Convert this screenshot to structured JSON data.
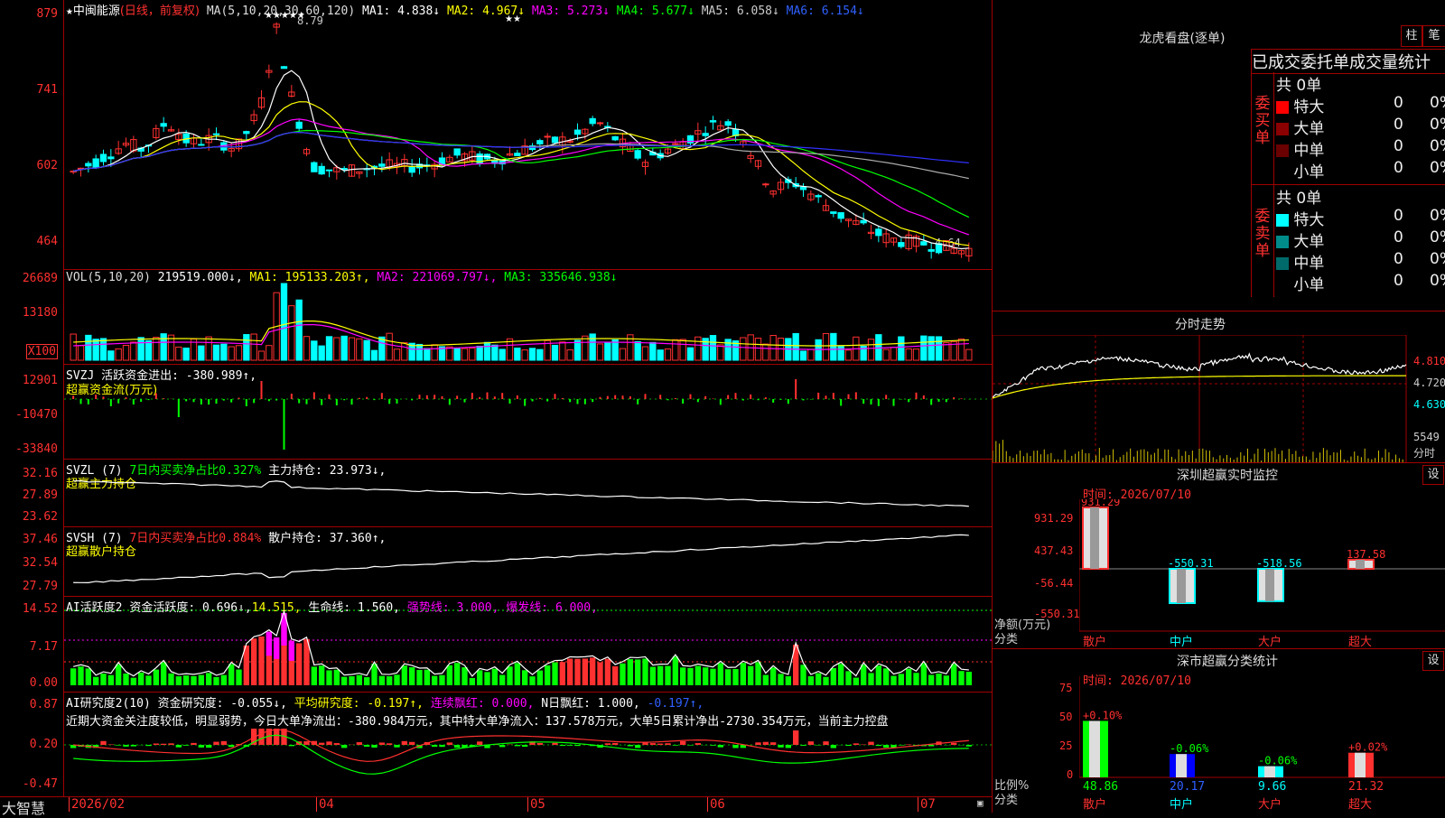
{
  "kline": {
    "title_star": "★",
    "stock": "中闽能源",
    "mode": "(日线，前复权)",
    "ma_label": "MA(5,10,20,30,60,120)",
    "ma": [
      {
        "label": "MA1: 4.838↓",
        "color": "#ffffff"
      },
      {
        "label": "MA2: 4.967↓",
        "color": "#ffff00"
      },
      {
        "label": "MA3: 5.273↓",
        "color": "#ff00ff"
      },
      {
        "label": "MA4: 5.677↓",
        "color": "#00ff00"
      },
      {
        "label": "MA5: 6.058↓",
        "color": "#cccccc"
      },
      {
        "label": "MA6: 6.154↓",
        "color": "#3030ff"
      }
    ],
    "y_ticks": [
      "879",
      "741",
      "602",
      "464"
    ],
    "high_mark": "8.79",
    "low_mark": "4.64",
    "stars": "★★★★★",
    "stars2": "★★"
  },
  "vol": {
    "header": "VOL(5,10,20)",
    "v": "219519.000↓,",
    "ma1": "MA1: 195133.203↑,",
    "ma2": "MA2: 221069.797↓,",
    "ma3": "MA3: 335646.938↓",
    "y_ticks": [
      "26689",
      "13180"
    ],
    "unit": "X100"
  },
  "svzj": {
    "header": "SVZJ  活跃资金进出: -380.989↑,",
    "sub": "超赢资金流(万元)",
    "y_ticks": [
      "12901",
      "-10470",
      "-33840"
    ]
  },
  "svzl": {
    "name": "SVZL (7)",
    "ratio": "7日内买卖净占比0.327%",
    "hold": "主力持仓: 23.973↓,",
    "sub": "超赢主力持仓",
    "y_ticks": [
      "32.16",
      "27.89",
      "23.62"
    ]
  },
  "svsh": {
    "name": "SVSH (7)",
    "ratio": "7日内买卖净占比0.884%",
    "hold": "散户持仓: 37.360↑,",
    "sub": "超赢散户持仓",
    "y_ticks": [
      "37.46",
      "32.54",
      "27.79"
    ]
  },
  "ai1": {
    "name": "AI活跃度2",
    "a": "资金活跃度: 0.696↓,",
    "b": "14.515,",
    "c": "生命线: 1.560,",
    "d": "强势线: 3.000,",
    "e": "爆发线: 6.000,",
    "y_ticks": [
      "14.52",
      "7.17",
      "0.00"
    ]
  },
  "ai2": {
    "name": "AI研究度2(10)",
    "a": "资金研究度: -0.055↓,",
    "b": "平均研究度: -0.197↑,",
    "c": "连续飘红: 0.000,",
    "d": "N日飘红: 1.000,",
    "e": "-0.197↑,",
    "comment": "近期大资金关注度较低，明显弱势，今日大单净流出：-380.984万元，其中特大单净流入：137.578万元，大单5日累计净出-2730.354万元，当前主力控盘",
    "y_ticks": [
      "0.87",
      "0.20",
      "-0.47"
    ]
  },
  "xaxis": {
    "brand": "大智慧",
    "labels": [
      "2026/02",
      "04",
      "05",
      "06",
      "07"
    ]
  },
  "lhb": {
    "title": "龙虎看盘(逐单)",
    "btn1": "柱",
    "btn2": "笔",
    "subtitle": "已成交委托单成交量统计",
    "buy_label": "委买单",
    "sell_label": "委卖单",
    "buy_total": "共 0单",
    "sell_total": "共 0单",
    "buy_rows": [
      {
        "name": "特大",
        "count": "0",
        "pct": "0%",
        "color": "#ff0000"
      },
      {
        "name": "大单",
        "count": "0",
        "pct": "0%",
        "color": "#8b0000"
      },
      {
        "name": "中单",
        "count": "0",
        "pct": "0%",
        "color": "#6a0000"
      },
      {
        "name": "小单",
        "count": "0",
        "pct": "0%",
        "color": "#000000"
      }
    ],
    "sell_rows": [
      {
        "name": "特大",
        "count": "0",
        "pct": "0%",
        "color": "#00ffff"
      },
      {
        "name": "大单",
        "count": "0",
        "pct": "0%",
        "color": "#008b8b"
      },
      {
        "name": "中单",
        "count": "0",
        "pct": "0%",
        "color": "#006a6a"
      },
      {
        "name": "小单",
        "count": "0",
        "pct": "0%",
        "color": "#000000"
      }
    ]
  },
  "fenshi": {
    "title": "分时走势",
    "y_ticks": [
      "4.810",
      "4.720",
      "4.630"
    ],
    "vol": "5549",
    "vol_unit": "分时"
  },
  "monitor": {
    "title": "深圳超赢实时监控",
    "btn": "设",
    "time": "时间: 2026/07/10",
    "y_ticks": [
      "931.29",
      "437.43",
      "-56.44",
      "-550.31"
    ],
    "ylabel": "净额(万元)",
    "xlabel": "分类",
    "bars": [
      {
        "cat": "散户",
        "label": "931.29",
        "value": 931.29
      },
      {
        "cat": "中户",
        "label": "-550.31",
        "value": -550.31
      },
      {
        "cat": "大户",
        "label": "-518.56",
        "value": -518.56
      },
      {
        "cat": "超大",
        "label": "137.58",
        "value": 137.58
      }
    ]
  },
  "classify": {
    "title": "深市超赢分类统计",
    "btn": "设",
    "time": "时间: 2026/07/10",
    "y_ticks": [
      "75",
      "50",
      "25",
      "0"
    ],
    "ylabel": "比例%",
    "xlabel": "分类",
    "bars": [
      {
        "cat": "散户",
        "top": "+0.10%",
        "value": 48.86,
        "bottom": "48.86"
      },
      {
        "cat": "中户",
        "top": "-0.06%",
        "value": 20.17,
        "bottom": "20.17"
      },
      {
        "cat": "大户",
        "top": "-0.06%",
        "value": 9.66,
        "bottom": "9.66"
      },
      {
        "cat": "超大",
        "top": "+0.02%",
        "value": 21.32,
        "bottom": "21.32"
      }
    ]
  },
  "colors": {
    "up": "#ff3030",
    "down": "#00ffff",
    "grid": "#a00000"
  }
}
